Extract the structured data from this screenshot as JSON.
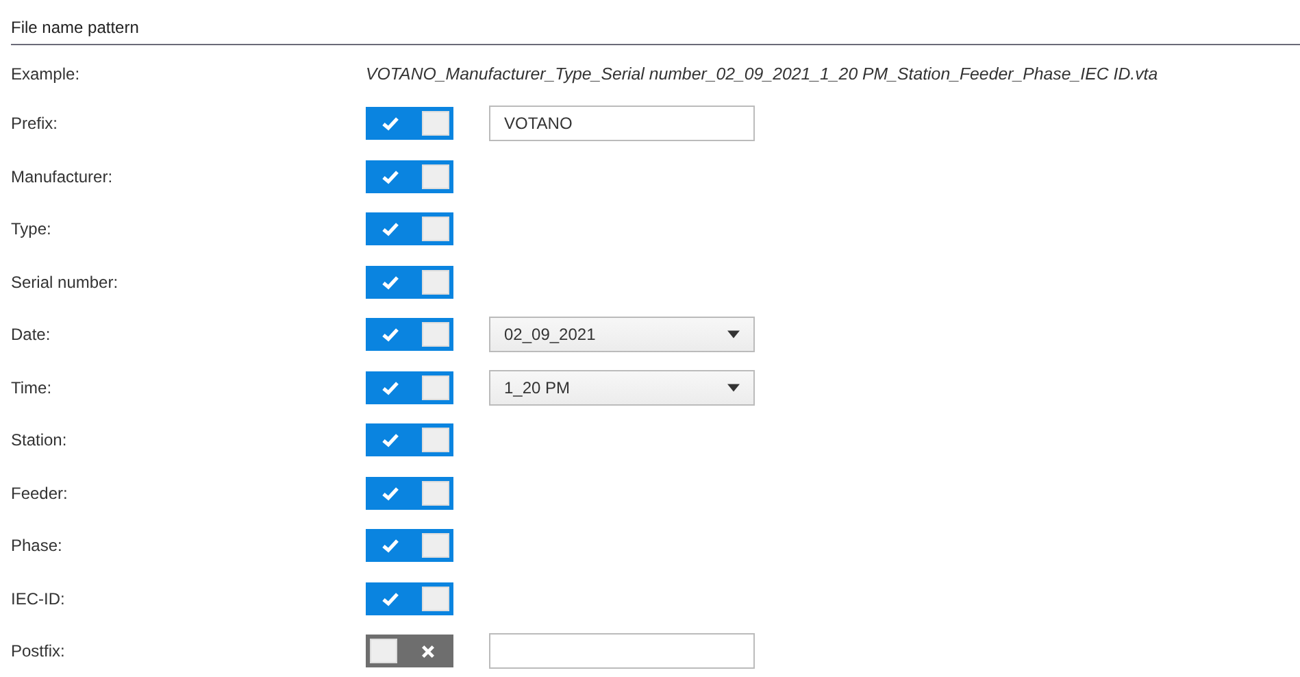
{
  "section": {
    "title": "File name pattern"
  },
  "example": {
    "label": "Example:",
    "value": "VOTANO_Manufacturer_Type_Serial number_02_09_2021_1_20 PM_Station_Feeder_Phase_IEC ID.vta"
  },
  "rows": [
    {
      "label": "Prefix:",
      "on": true,
      "kind": "text",
      "value": "VOTANO"
    },
    {
      "label": "Manufacturer:",
      "on": true
    },
    {
      "label": "Type:",
      "on": true
    },
    {
      "label": "Serial number:",
      "on": true
    },
    {
      "label": "Date:",
      "on": true,
      "kind": "select",
      "value": "02_09_2021"
    },
    {
      "label": "Time:",
      "on": true,
      "kind": "select",
      "value": "1_20 PM"
    },
    {
      "label": "Station:",
      "on": true
    },
    {
      "label": "Feeder:",
      "on": true
    },
    {
      "label": "Phase:",
      "on": true
    },
    {
      "label": "IEC-ID:",
      "on": true
    },
    {
      "label": "Postfix:",
      "on": false,
      "kind": "text"
    }
  ]
}
